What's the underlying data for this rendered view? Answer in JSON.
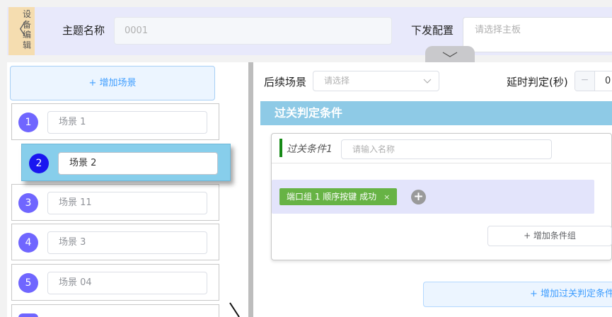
{
  "header": {
    "back_tab_label": [
      "设",
      "备",
      "编",
      "辑"
    ],
    "topic_label": "主题名称",
    "topic_value": "0001",
    "dispatch_label": "下发配置",
    "board_placeholder": "请选择主板"
  },
  "scenes": {
    "add_label": "+ 增加场景",
    "items": [
      {
        "num": "1",
        "name": "场景 1"
      },
      {
        "num": "2",
        "name": "场景 2",
        "active": true
      },
      {
        "num": "3",
        "name": "场景 11"
      },
      {
        "num": "4",
        "name": "场景 3"
      },
      {
        "num": "5",
        "name": "场景 04"
      }
    ]
  },
  "config": {
    "next_scene_label": "后续场景",
    "next_scene_placeholder": "请选择",
    "delay_label": "延时判定(秒)",
    "delay_minus": "−",
    "delay_value": "0",
    "section_title": "过关判定条件",
    "condition": {
      "title": "过关条件1",
      "name_placeholder": "请输入名称",
      "tag_label": "端口组 1 顺序按键 成功",
      "tag_close": "×",
      "add_condition_symbol": "+",
      "add_group_label": "+ 增加条件组"
    },
    "add_pass_label": "+ 增加过关判定条件"
  },
  "colors": {
    "accent_blue": "#409eff",
    "scene_badge": "#7066ff",
    "scene_badge_active": "#1a16f0",
    "active_scene_bg": "#87ceeb",
    "section_header_bg": "#8ecae6",
    "tag_green": "#67b345",
    "condition_bar": "#178a17"
  }
}
